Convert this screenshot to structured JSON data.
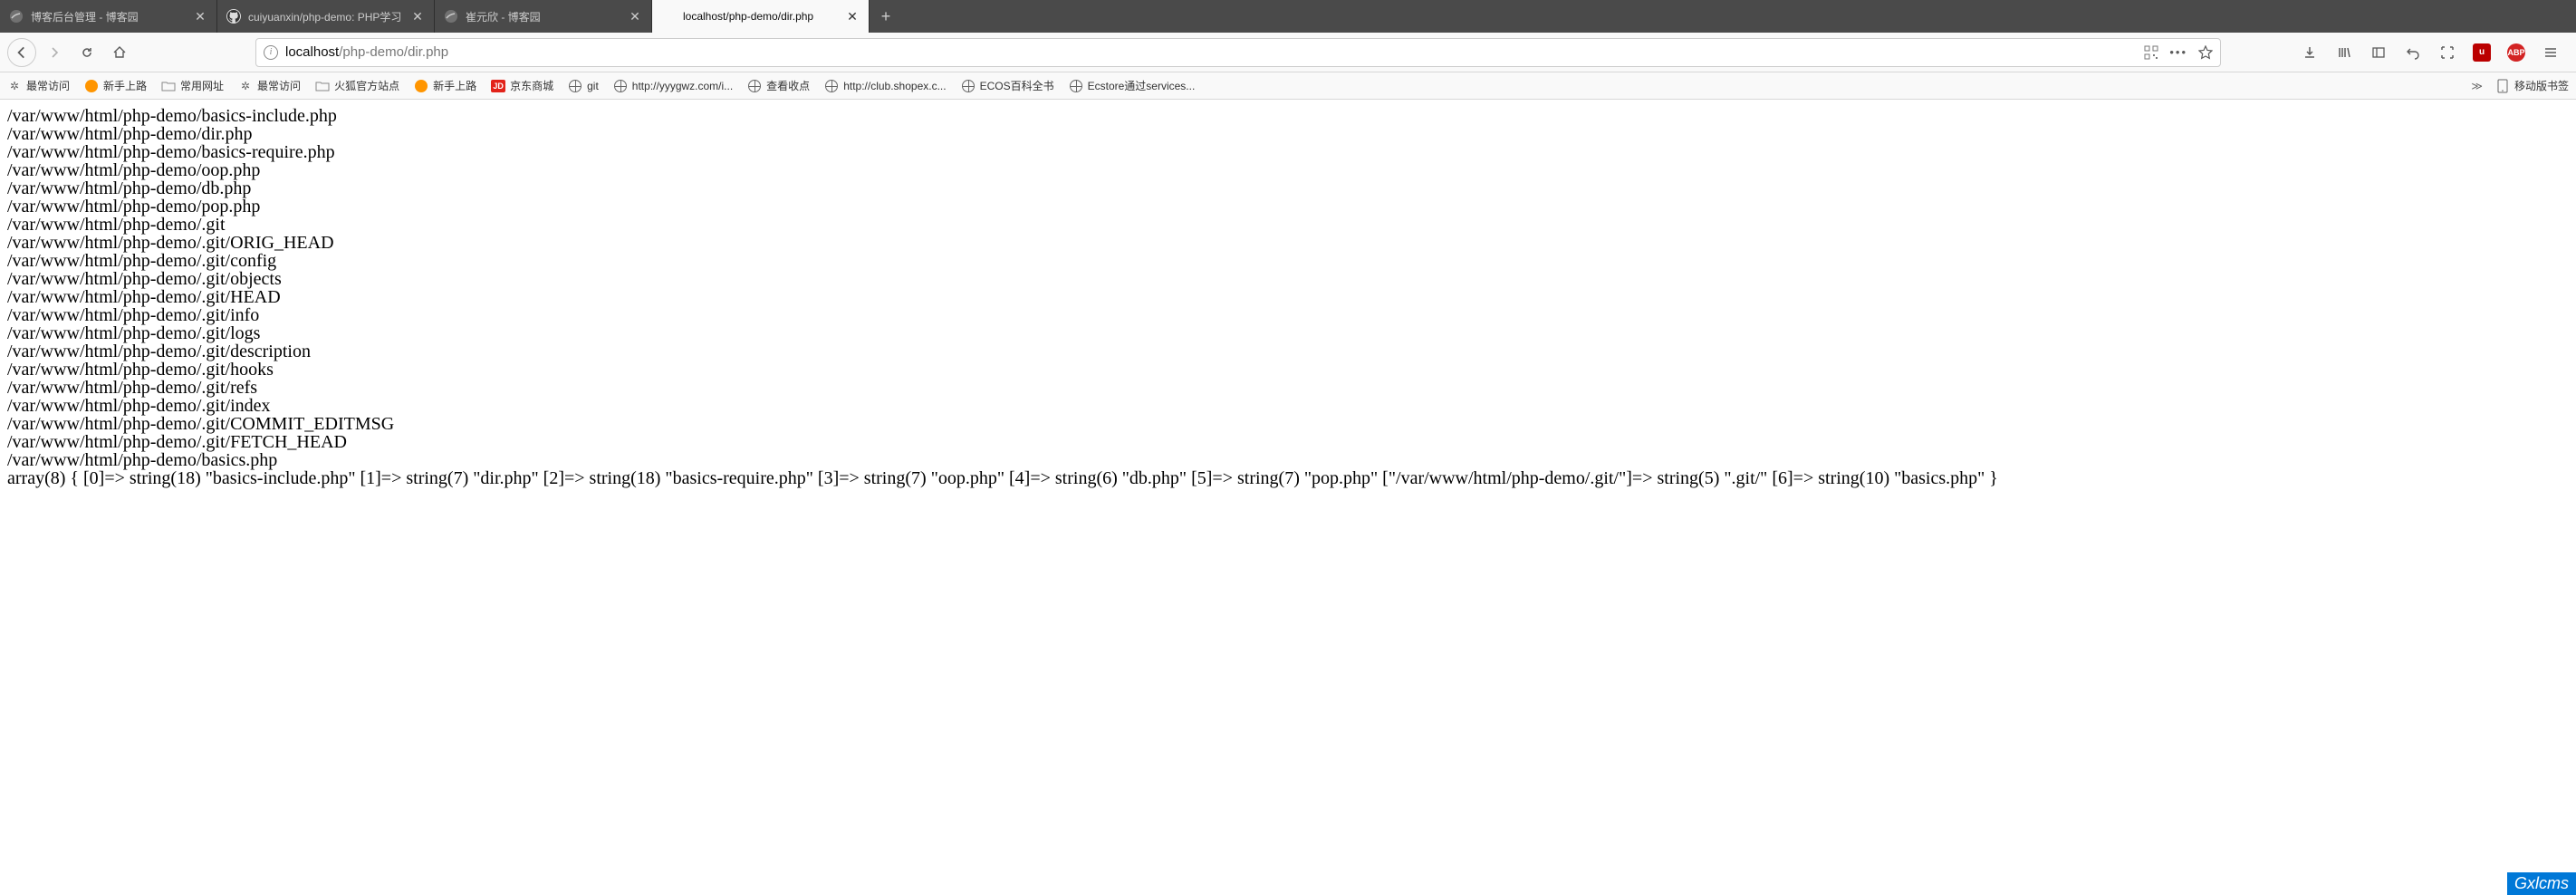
{
  "tabs": [
    {
      "title": "博客后台管理 - 博客园",
      "favicon": "cnblogs",
      "active": false
    },
    {
      "title": "cuiyuanxin/php-demo: PHP学习",
      "favicon": "github",
      "active": false
    },
    {
      "title": "崔元欣 - 博客园",
      "favicon": "cnblogs",
      "active": false
    },
    {
      "title": "localhost/php-demo/dir.php",
      "favicon": "none",
      "active": true
    }
  ],
  "url": {
    "host": "localhost",
    "path": "/php-demo/dir.php",
    "full": "localhost/php-demo/dir.php"
  },
  "bookmarks": [
    {
      "icon": "gear",
      "label": "最常访问"
    },
    {
      "icon": "firefox",
      "label": "新手上路"
    },
    {
      "icon": "folder",
      "label": "常用网址"
    },
    {
      "icon": "gear",
      "label": "最常访问"
    },
    {
      "icon": "folder",
      "label": "火狐官方站点"
    },
    {
      "icon": "firefox",
      "label": "新手上路"
    },
    {
      "icon": "jd",
      "label": "京东商城"
    },
    {
      "icon": "globe",
      "label": "git"
    },
    {
      "icon": "globe",
      "label": "http://yyygwz.com/i..."
    },
    {
      "icon": "globe",
      "label": "查看收点"
    },
    {
      "icon": "globe",
      "label": "http://club.shopex.c..."
    },
    {
      "icon": "globe",
      "label": "ECOS百科全书"
    },
    {
      "icon": "globe",
      "label": "Ecstore通过services..."
    }
  ],
  "bookmarks_overflow_label": "移动版书签",
  "page_lines": [
    "/var/www/html/php-demo/basics-include.php",
    "/var/www/html/php-demo/dir.php",
    "/var/www/html/php-demo/basics-require.php",
    "/var/www/html/php-demo/oop.php",
    "/var/www/html/php-demo/db.php",
    "/var/www/html/php-demo/pop.php",
    "/var/www/html/php-demo/.git",
    "/var/www/html/php-demo/.git/ORIG_HEAD",
    "/var/www/html/php-demo/.git/config",
    "/var/www/html/php-demo/.git/objects",
    "/var/www/html/php-demo/.git/HEAD",
    "/var/www/html/php-demo/.git/info",
    "/var/www/html/php-demo/.git/logs",
    "/var/www/html/php-demo/.git/description",
    "/var/www/html/php-demo/.git/hooks",
    "/var/www/html/php-demo/.git/refs",
    "/var/www/html/php-demo/.git/index",
    "/var/www/html/php-demo/.git/COMMIT_EDITMSG",
    "/var/www/html/php-demo/.git/FETCH_HEAD",
    "/var/www/html/php-demo/basics.php"
  ],
  "page_dump": "array(8) { [0]=> string(18) \"basics-include.php\" [1]=> string(7) \"dir.php\" [2]=> string(18) \"basics-require.php\" [3]=> string(7) \"oop.php\" [4]=> string(6) \"db.php\" [5]=> string(7) \"pop.php\" [\"/var/www/html/php-demo/.git/\"]=> string(5) \".git/\" [6]=> string(10) \"basics.php\" }",
  "watermark_br": "Gxlcms"
}
